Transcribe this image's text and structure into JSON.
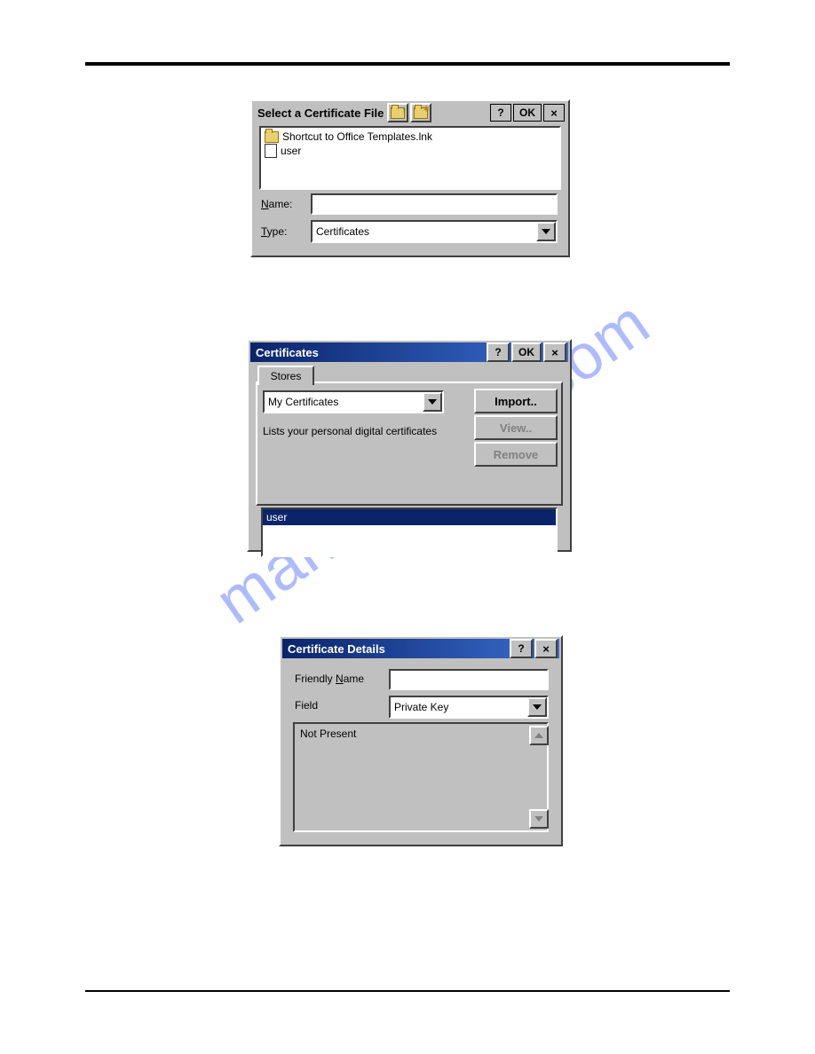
{
  "watermark": "manualshive.com",
  "dlg1": {
    "title": "Select a Certificate File",
    "icons": {
      "folder_up": "folder-up-icon",
      "new_folder": "new-folder-icon"
    },
    "tbar_help": "?",
    "tbar_ok": "OK",
    "tbar_close": "×",
    "files": [
      {
        "name": "Shortcut to Office Templates.lnk",
        "icon": "folder"
      },
      {
        "name": "user",
        "icon": "file"
      }
    ],
    "name_label_pre": "",
    "name_label_u": "N",
    "name_label_post": "ame:",
    "name_value": "",
    "type_label_pre": "",
    "type_label_u": "T",
    "type_label_post": "ype:",
    "type_value": "Certificates"
  },
  "dlg2": {
    "title": "Certificates",
    "tbar_help": "?",
    "tbar_ok": "OK",
    "tbar_close": "×",
    "tab_label": "Stores",
    "store_selected": "My Certificates",
    "desc": "Lists your personal digital certificates",
    "btn_import": "Import..",
    "btn_view": "View..",
    "btn_remove": "Remove",
    "list_selected": "user"
  },
  "dlg3": {
    "title": "Certificate Details",
    "tbar_help": "?",
    "tbar_close": "×",
    "fname_label_pre": "Friendly ",
    "fname_label_u": "N",
    "fname_label_post": "ame",
    "fname_value": "",
    "field_label": "Field",
    "field_value": "Private Key",
    "detail_text": "Not Present"
  }
}
